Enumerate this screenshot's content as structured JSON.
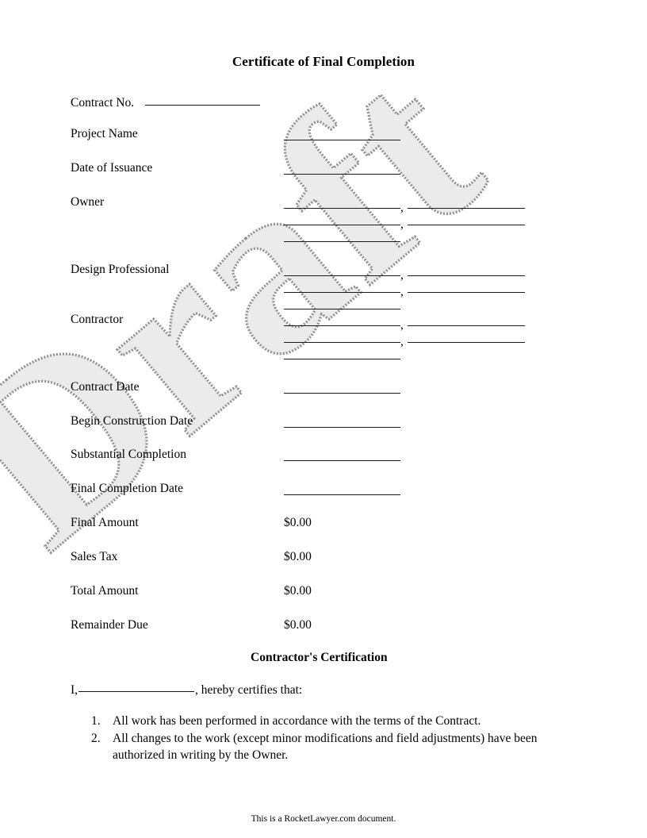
{
  "document": {
    "title": "Certificate of Final Completion",
    "watermark": "Draft",
    "footer": "This is a RocketLawyer.com document."
  },
  "fields": [
    {
      "label": "Contract No.",
      "kind": "inline_rule"
    },
    {
      "label": "Project Name",
      "kind": "single_rule"
    },
    {
      "label": "Date of Issuance",
      "kind": "single_rule"
    },
    {
      "label": "Owner",
      "kind": "address_block"
    },
    {
      "label": "Design Professional",
      "kind": "address_block"
    },
    {
      "label": "Contractor",
      "kind": "address_block"
    },
    {
      "label": "Contract Date",
      "kind": "single_rule"
    },
    {
      "label": "Begin Construction Date",
      "kind": "single_rule"
    },
    {
      "label": "Substantial Completion",
      "kind": "single_rule"
    },
    {
      "label": "Final Completion Date",
      "kind": "single_rule"
    }
  ],
  "amounts": [
    {
      "label": "Final Amount",
      "value": "$0.00"
    },
    {
      "label": "Sales Tax",
      "value": "$0.00"
    },
    {
      "label": "Total Amount",
      "value": "$0.00"
    },
    {
      "label": "Remainder Due",
      "value": "$0.00"
    }
  ],
  "certification": {
    "heading": "Contractor's Certification",
    "intro_prefix": "I,",
    "intro_suffix": ", hereby certifies that:",
    "items": [
      "All work has been performed in accordance with the terms of the Contract.",
      "All changes to the work (except minor modifications and field adjustments) have been authorized in writing by the Owner."
    ],
    "item_numbers": [
      "1.",
      "2."
    ]
  },
  "separators": {
    "comma": ","
  }
}
